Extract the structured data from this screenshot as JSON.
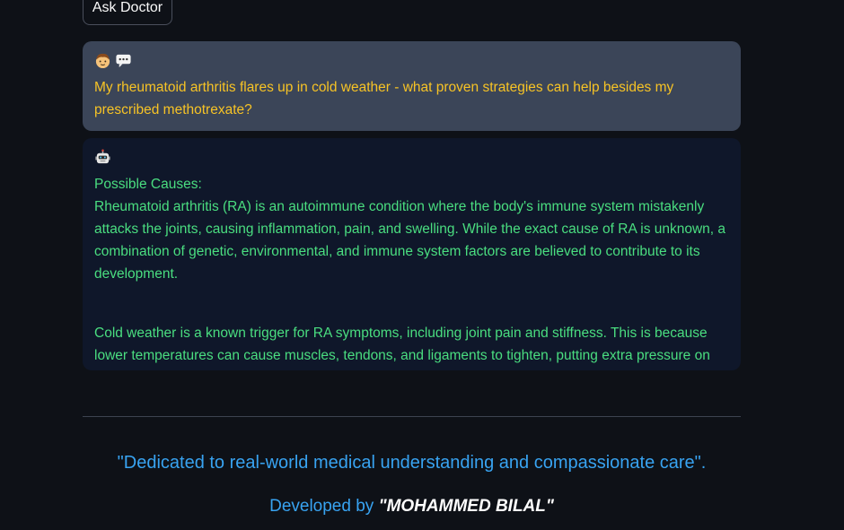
{
  "ask_button": {
    "label": "Ask Doctor"
  },
  "user_message": {
    "avatar_icon": "boy-face-icon",
    "chat_icon": "speech-bubble-icon",
    "text": "My rheumatoid arthritis flares up in cold weather - what proven strategies can help besides my prescribed methotrexate?"
  },
  "bot_message": {
    "avatar_icon": "robot-face-icon",
    "heading": "Possible Causes:",
    "paragraph1": "Rheumatoid arthritis (RA) is an autoimmune condition where the body's immune system mistakenly attacks the joints, causing inflammation, pain, and swelling. While the exact cause of RA is unknown, a combination of genetic, environmental, and immune system factors are believed to contribute to its development.",
    "paragraph2": "Cold weather is a known trigger for RA symptoms, including joint pain and stiffness. This is because lower temperatures can cause muscles, tendons, and ligaments to tighten, putting extra pressure on the joints."
  },
  "footer": {
    "quote": "\"Dedicated to real-world medical understanding and compassionate care\".",
    "developed_by_label": "Developed by ",
    "developer_name": "\"MOHAMMED BILAL\""
  },
  "colors": {
    "background": "#0e1117",
    "user_card": "#3b4558",
    "bot_card": "#0f172a",
    "user_text": "#f7c325",
    "bot_text": "#4ade80",
    "footer_text": "#38a3f1"
  }
}
